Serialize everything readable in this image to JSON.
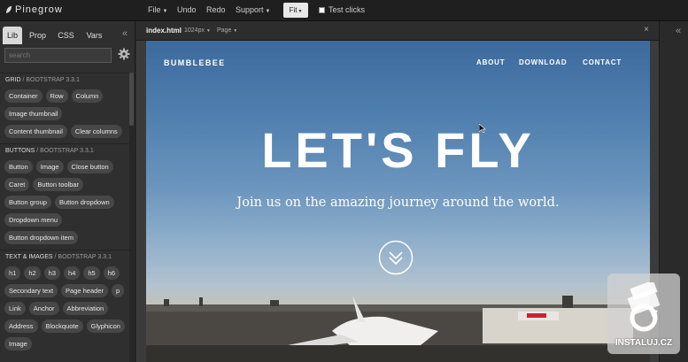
{
  "app": {
    "name": "Pinegrow"
  },
  "menu": {
    "file": "File",
    "undo": "Undo",
    "redo": "Redo",
    "support": "Support",
    "fit": "Fit",
    "test_clicks": "Test clicks"
  },
  "left_panel": {
    "tabs": [
      {
        "label": "Lib",
        "active": true
      },
      {
        "label": "Prop",
        "active": false
      },
      {
        "label": "CSS",
        "active": false
      },
      {
        "label": "Vars",
        "active": false
      }
    ],
    "search_placeholder": "search",
    "sections": [
      {
        "title": "GRID",
        "version": " / BOOTSTRAP 3.3.1",
        "items": [
          "Container",
          "Row",
          "Column",
          "Image thumbnail",
          "Content thumbnail",
          "Clear columns"
        ]
      },
      {
        "title": "BUTTONS",
        "version": " / BOOTSTRAP 3.3.1",
        "items": [
          "Button",
          "Image",
          "Close button",
          "Caret",
          "Button toolbar",
          "Button group",
          "Button dropdown",
          "Dropdown menu",
          "Button dropdown item"
        ]
      },
      {
        "title": "TEXT & IMAGES",
        "version": " / BOOTSTRAP 3.3.1",
        "items": [
          "h1",
          "h2",
          "h3",
          "h4",
          "h5",
          "h6",
          "Secondary text",
          "Page header",
          "p",
          "Link",
          "Anchor",
          "Abbreviation",
          "Address",
          "Blockquote",
          "Glyphicon",
          "Image"
        ]
      }
    ]
  },
  "document": {
    "filename": "index.html",
    "size": "1024px",
    "page_menu": "Page",
    "close": "×"
  },
  "preview": {
    "brand": "BUMBLEBEE",
    "nav": [
      "ABOUT",
      "DOWNLOAD",
      "CONTACT"
    ],
    "hero": "LET'S FLY",
    "subtitle": "Join us on the amazing journey around the world."
  },
  "watermark": {
    "text": "INSTALUJ.CZ"
  },
  "colors": {
    "toolbar_bg": "#1f1f1f",
    "panel_bg": "#2f2f2f",
    "chip_bg": "#474747",
    "sky_top": "#3d6a9d",
    "sky_horizon": "#b2c2cf"
  }
}
